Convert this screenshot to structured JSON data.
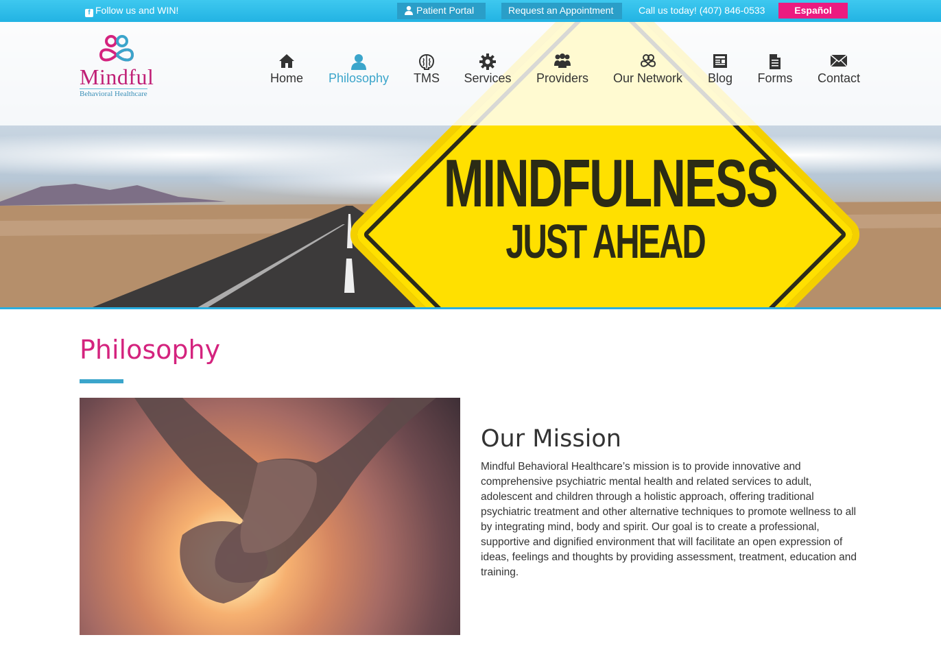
{
  "topbar": {
    "follow_label": "Follow us and WIN!",
    "portal_label": "Patient Portal",
    "appointment_label": "Request an Appointment",
    "call_label": "Call us today! (407) 846-0533",
    "language_label": "Español"
  },
  "logo": {
    "name": "Mindful",
    "subtitle": "Behavioral Healthcare"
  },
  "nav": {
    "items": [
      {
        "label": "Home",
        "icon": "home-icon"
      },
      {
        "label": "Philosophy",
        "icon": "user-icon",
        "active": true
      },
      {
        "label": "TMS",
        "icon": "brain-icon"
      },
      {
        "label": "Services",
        "icon": "gear-icon"
      },
      {
        "label": "Providers",
        "icon": "group-icon"
      },
      {
        "label": "Our Network",
        "icon": "network-icon"
      },
      {
        "label": "Blog",
        "icon": "newspaper-icon"
      },
      {
        "label": "Forms",
        "icon": "document-icon"
      },
      {
        "label": "Contact",
        "icon": "envelope-icon"
      }
    ]
  },
  "hero": {
    "sign_line1": "MINDFULNESS",
    "sign_line2": "JUST AHEAD"
  },
  "main": {
    "page_title": "Philosophy",
    "mission_title": "Our Mission",
    "mission_text": "Mindful Behavioral Healthcare’s mission is to provide innovative and comprehensive psychiatric mental health and related services to adult, adolescent and children through a holistic approach, offering traditional psychiatric treatment and other alternative techniques to promote wellness to all by integrating mind, body and spirit. Our goal is to create a professional, supportive and dignified environment that will facilitate an open expression of ideas, feelings and thoughts by providing assessment, treatment, education and training."
  },
  "colors": {
    "topbar": "#2bb8e6",
    "accent_blue": "#3ba5cb",
    "brand_pink": "#d4237e",
    "espanol_pink": "#ec1b80"
  }
}
